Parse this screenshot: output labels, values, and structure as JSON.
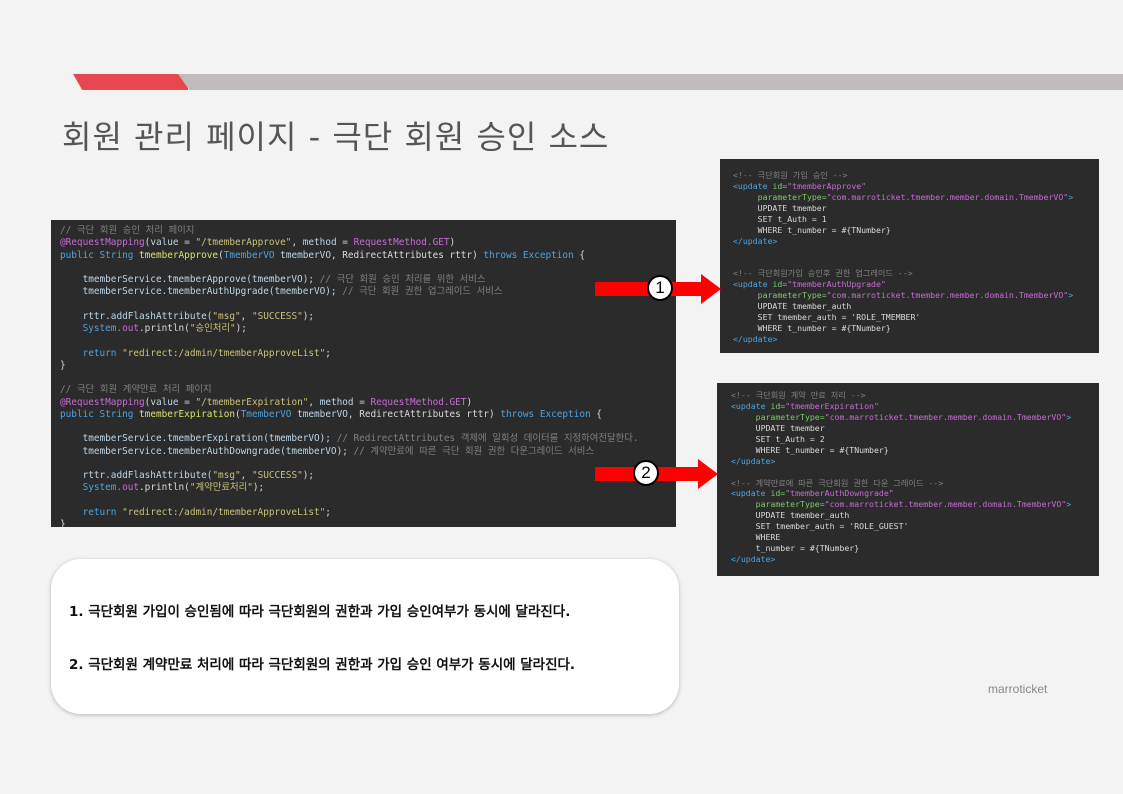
{
  "header": {
    "title": "회원 관리 페이지 - 극단 회원 승인 소스"
  },
  "java_code": {
    "lines": [
      [
        {
          "c": "c",
          "t": "// 극단 회원 승인 처리 페이지"
        }
      ],
      [
        {
          "c": "a",
          "t": "@RequestMapping"
        },
        {
          "c": "t",
          "t": "("
        },
        {
          "c": "v",
          "t": "value"
        },
        {
          "c": "t",
          "t": " = "
        },
        {
          "c": "s",
          "t": "\"/tmemberApprove\""
        },
        {
          "c": "t",
          "t": ", "
        },
        {
          "c": "v",
          "t": "method"
        },
        {
          "c": "t",
          "t": " = "
        },
        {
          "c": "a",
          "t": "RequestMethod.GET"
        },
        {
          "c": "t",
          "t": ")"
        }
      ],
      [
        {
          "c": "k",
          "t": "public "
        },
        {
          "c": "k",
          "t": "String "
        },
        {
          "c": "f",
          "t": "tmemberApprove"
        },
        {
          "c": "t",
          "t": "("
        },
        {
          "c": "k",
          "t": "TmemberVO "
        },
        {
          "c": "v",
          "t": "tmemberVO"
        },
        {
          "c": "t",
          "t": ", RedirectAttributes rttr) "
        },
        {
          "c": "k",
          "t": "throws "
        },
        {
          "c": "k",
          "t": "Exception"
        },
        {
          "c": "t",
          "t": " {"
        }
      ],
      [],
      [
        {
          "c": "v",
          "t": "    tmemberService.tmemberApprove(tmemberVO); "
        },
        {
          "c": "c",
          "t": "// 극단 회원 승인 처리를 위한 서비스"
        }
      ],
      [
        {
          "c": "v",
          "t": "    tmemberService.tmemberAuthUpgrade(tmemberVO); "
        },
        {
          "c": "c",
          "t": "// 극단 회원 권한 업그레이드 서비스"
        }
      ],
      [],
      [
        {
          "c": "v",
          "t": "    rttr.addFlashAttribute("
        },
        {
          "c": "s",
          "t": "\"msg\""
        },
        {
          "c": "t",
          "t": ", "
        },
        {
          "c": "s",
          "t": "\"SUCCESS\""
        },
        {
          "c": "t",
          "t": ");"
        }
      ],
      [
        {
          "c": "k",
          "t": "    System."
        },
        {
          "c": "a",
          "t": "out"
        },
        {
          "c": "t",
          "t": ".println("
        },
        {
          "c": "s",
          "t": "\"승인처리\""
        },
        {
          "c": "t",
          "t": ");"
        }
      ],
      [],
      [
        {
          "c": "k",
          "t": "    return "
        },
        {
          "c": "s",
          "t": "\"redirect:/admin/tmemberApproveList\""
        },
        {
          "c": "t",
          "t": ";"
        }
      ],
      [
        {
          "c": "t",
          "t": "}"
        }
      ],
      [],
      [
        {
          "c": "c",
          "t": "// 극단 회원 계약만료 처리 페이지"
        }
      ],
      [
        {
          "c": "a",
          "t": "@RequestMapping"
        },
        {
          "c": "t",
          "t": "("
        },
        {
          "c": "v",
          "t": "value"
        },
        {
          "c": "t",
          "t": " = "
        },
        {
          "c": "s",
          "t": "\"/tmemberExpiration\""
        },
        {
          "c": "t",
          "t": ", "
        },
        {
          "c": "v",
          "t": "method"
        },
        {
          "c": "t",
          "t": " = "
        },
        {
          "c": "a",
          "t": "RequestMethod.GET"
        },
        {
          "c": "t",
          "t": ")"
        }
      ],
      [
        {
          "c": "k",
          "t": "public "
        },
        {
          "c": "k",
          "t": "String "
        },
        {
          "c": "f",
          "t": "tmemberExpiration"
        },
        {
          "c": "t",
          "t": "("
        },
        {
          "c": "k",
          "t": "TmemberVO "
        },
        {
          "c": "v",
          "t": "tmemberVO"
        },
        {
          "c": "t",
          "t": ", RedirectAttributes rttr) "
        },
        {
          "c": "k",
          "t": "throws "
        },
        {
          "c": "k",
          "t": "Exception"
        },
        {
          "c": "t",
          "t": " {"
        }
      ],
      [],
      [
        {
          "c": "v",
          "t": "    tmemberService.tmemberExpiration(tmemberVO); "
        },
        {
          "c": "c",
          "t": "// RedirectAttributes 객체에 일회성 데이터를 지정하여전달한다."
        }
      ],
      [
        {
          "c": "v",
          "t": "    tmemberService.tmemberAuthDowngrade(tmemberVO); "
        },
        {
          "c": "c",
          "t": "// 계약만료에 따른 극단 회원 권한 다운그레이드 서비스"
        }
      ],
      [],
      [
        {
          "c": "v",
          "t": "    rttr.addFlashAttribute("
        },
        {
          "c": "s",
          "t": "\"msg\""
        },
        {
          "c": "t",
          "t": ", "
        },
        {
          "c": "s",
          "t": "\"SUCCESS\""
        },
        {
          "c": "t",
          "t": ");"
        }
      ],
      [
        {
          "c": "k",
          "t": "    System."
        },
        {
          "c": "a",
          "t": "out"
        },
        {
          "c": "t",
          "t": ".println("
        },
        {
          "c": "s",
          "t": "\"계약만료처리\""
        },
        {
          "c": "t",
          "t": ");"
        }
      ],
      [],
      [
        {
          "c": "k",
          "t": "    return "
        },
        {
          "c": "s",
          "t": "\"redirect:/admin/tmemberApproveList\""
        },
        {
          "c": "t",
          "t": ";"
        }
      ],
      [
        {
          "c": "t",
          "t": "}"
        }
      ]
    ]
  },
  "sql_upgrade": {
    "lines": [
      [
        {
          "c": "c",
          "t": "<!-- 극단회원 가입 승인 -->"
        }
      ],
      [
        {
          "c": "k",
          "t": "<update "
        },
        {
          "c": "g",
          "t": "id="
        },
        {
          "c": "a",
          "t": "\"tmemberApprove\""
        }
      ],
      [
        {
          "c": "g",
          "t": "     parameterType="
        },
        {
          "c": "a",
          "t": "\"com.marroticket.tmember.member.domain.TmemberVO\""
        },
        {
          "c": "k",
          "t": ">"
        }
      ],
      [
        {
          "c": "t",
          "t": "     UPDATE tmember"
        }
      ],
      [
        {
          "c": "t",
          "t": "     SET t_Auth = 1"
        }
      ],
      [
        {
          "c": "t",
          "t": "     WHERE t_number = #{TNumber}"
        }
      ],
      [
        {
          "c": "k",
          "t": "</update>"
        }
      ],
      [],
      [],
      [
        {
          "c": "c",
          "t": "<!-- 극단회원가입 승인후 권한 업그레이드 -->"
        }
      ],
      [
        {
          "c": "k",
          "t": "<update "
        },
        {
          "c": "g",
          "t": "id="
        },
        {
          "c": "a",
          "t": "\"tmemberAuthUpgrade\""
        }
      ],
      [
        {
          "c": "g",
          "t": "     parameterType="
        },
        {
          "c": "a",
          "t": "\"com.marroticket.tmember.member.domain.TmemberVO\""
        },
        {
          "c": "k",
          "t": ">"
        }
      ],
      [
        {
          "c": "t",
          "t": "     UPDATE tmember_auth"
        }
      ],
      [
        {
          "c": "t",
          "t": "     SET tmember_auth = 'ROLE_TMEMBER'"
        }
      ],
      [
        {
          "c": "t",
          "t": "     WHERE t_number = #{TNumber}"
        }
      ],
      [
        {
          "c": "k",
          "t": "</update>"
        }
      ]
    ]
  },
  "sql_downgrade": {
    "lines": [
      [
        {
          "c": "c",
          "t": "<!-- 극단회원 계약 만료 처리 -->"
        }
      ],
      [
        {
          "c": "k",
          "t": "<update "
        },
        {
          "c": "g",
          "t": "id="
        },
        {
          "c": "a",
          "t": "\"tmemberExpiration\""
        }
      ],
      [
        {
          "c": "g",
          "t": "     parameterType="
        },
        {
          "c": "a",
          "t": "\"com.marroticket.tmember.member.domain.TmemberVO\""
        },
        {
          "c": "k",
          "t": ">"
        }
      ],
      [
        {
          "c": "t",
          "t": "     UPDATE tmember"
        }
      ],
      [
        {
          "c": "t",
          "t": "     SET t_Auth = 2"
        }
      ],
      [
        {
          "c": "t",
          "t": "     WHERE t_number = #{TNumber}"
        }
      ],
      [
        {
          "c": "k",
          "t": "</update>"
        }
      ],
      [],
      [
        {
          "c": "c",
          "t": "<!-- 계약만료에 따른 극단회원 권한 다운 그레이드 -->"
        }
      ],
      [
        {
          "c": "k",
          "t": "<update "
        },
        {
          "c": "g",
          "t": "id="
        },
        {
          "c": "a",
          "t": "\"tmemberAuthDowngrade\""
        }
      ],
      [
        {
          "c": "g",
          "t": "     parameterType="
        },
        {
          "c": "a",
          "t": "\"com.marroticket.tmember.member.domain.TmemberVO\""
        },
        {
          "c": "k",
          "t": ">"
        }
      ],
      [
        {
          "c": "t",
          "t": "     UPDATE tmember_auth"
        }
      ],
      [
        {
          "c": "t",
          "t": "     SET tmember_auth = 'ROLE_GUEST'"
        }
      ],
      [
        {
          "c": "t",
          "t": "     WHERE"
        }
      ],
      [
        {
          "c": "t",
          "t": "     t_number = #{TNumber}"
        }
      ],
      [
        {
          "c": "k",
          "t": "</update>"
        }
      ]
    ]
  },
  "markers": {
    "one": "1",
    "two": "2"
  },
  "notes": {
    "line1": "1. 극단회원 가입이 승인됨에 따라 극단회원의 권한과 가입 승인여부가 동시에 달라진다.",
    "line2": "2. 극단회원 계약만료 처리에 따라 극단회원의 권한과 가입 승인 여부가 동시에 달라진다."
  },
  "footer": {
    "brand": "marroticket"
  },
  "colors": {
    "accent_red": "#e8474f",
    "bar_gray": "#c2bbbc",
    "code_bg": "#2b2b2b",
    "arrow_red": "#ff0000"
  }
}
